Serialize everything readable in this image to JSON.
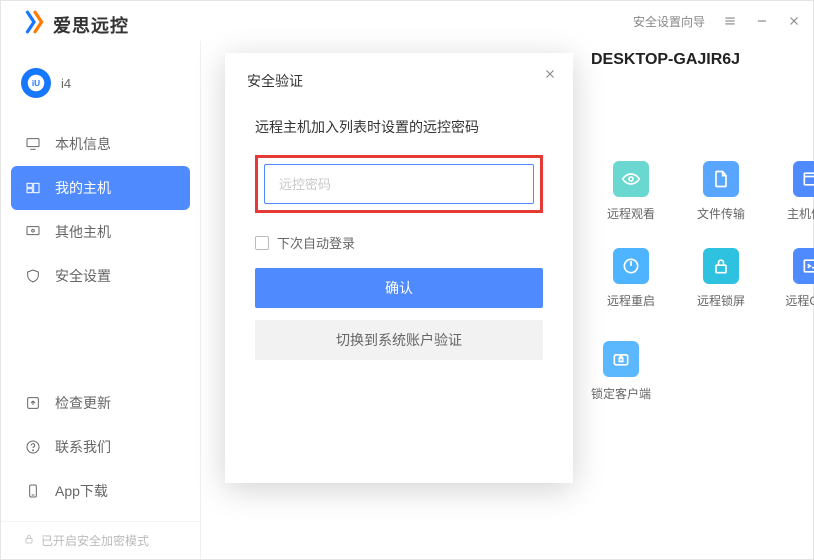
{
  "titlebar": {
    "wizard": "安全设置向导"
  },
  "brand": {
    "text": "爱思远控"
  },
  "account": {
    "name": "i4"
  },
  "sidebar": {
    "items": [
      {
        "label": "本机信息"
      },
      {
        "label": "我的主机"
      },
      {
        "label": "其他主机"
      },
      {
        "label": "安全设置"
      }
    ],
    "bottom": [
      {
        "label": "检查更新"
      },
      {
        "label": "联系我们"
      },
      {
        "label": "App下载"
      }
    ]
  },
  "footer": {
    "text": "已开启安全加密模式"
  },
  "host": {
    "name": "DESKTOP-GAJIR6J"
  },
  "actions": {
    "tiles": [
      {
        "label": "远程观看"
      },
      {
        "label": "文件传输"
      },
      {
        "label": "主机信息"
      },
      {
        "label": "远程重启"
      },
      {
        "label": "远程锁屏"
      },
      {
        "label": "远程CMD"
      }
    ],
    "lock": {
      "label": "锁定客户端"
    }
  },
  "modal": {
    "title": "安全验证",
    "message": "远程主机加入列表时设置的远控密码",
    "placeholder": "远控密码",
    "auto_login": "下次自动登录",
    "confirm": "确认",
    "switch": "切换到系统账户验证"
  }
}
